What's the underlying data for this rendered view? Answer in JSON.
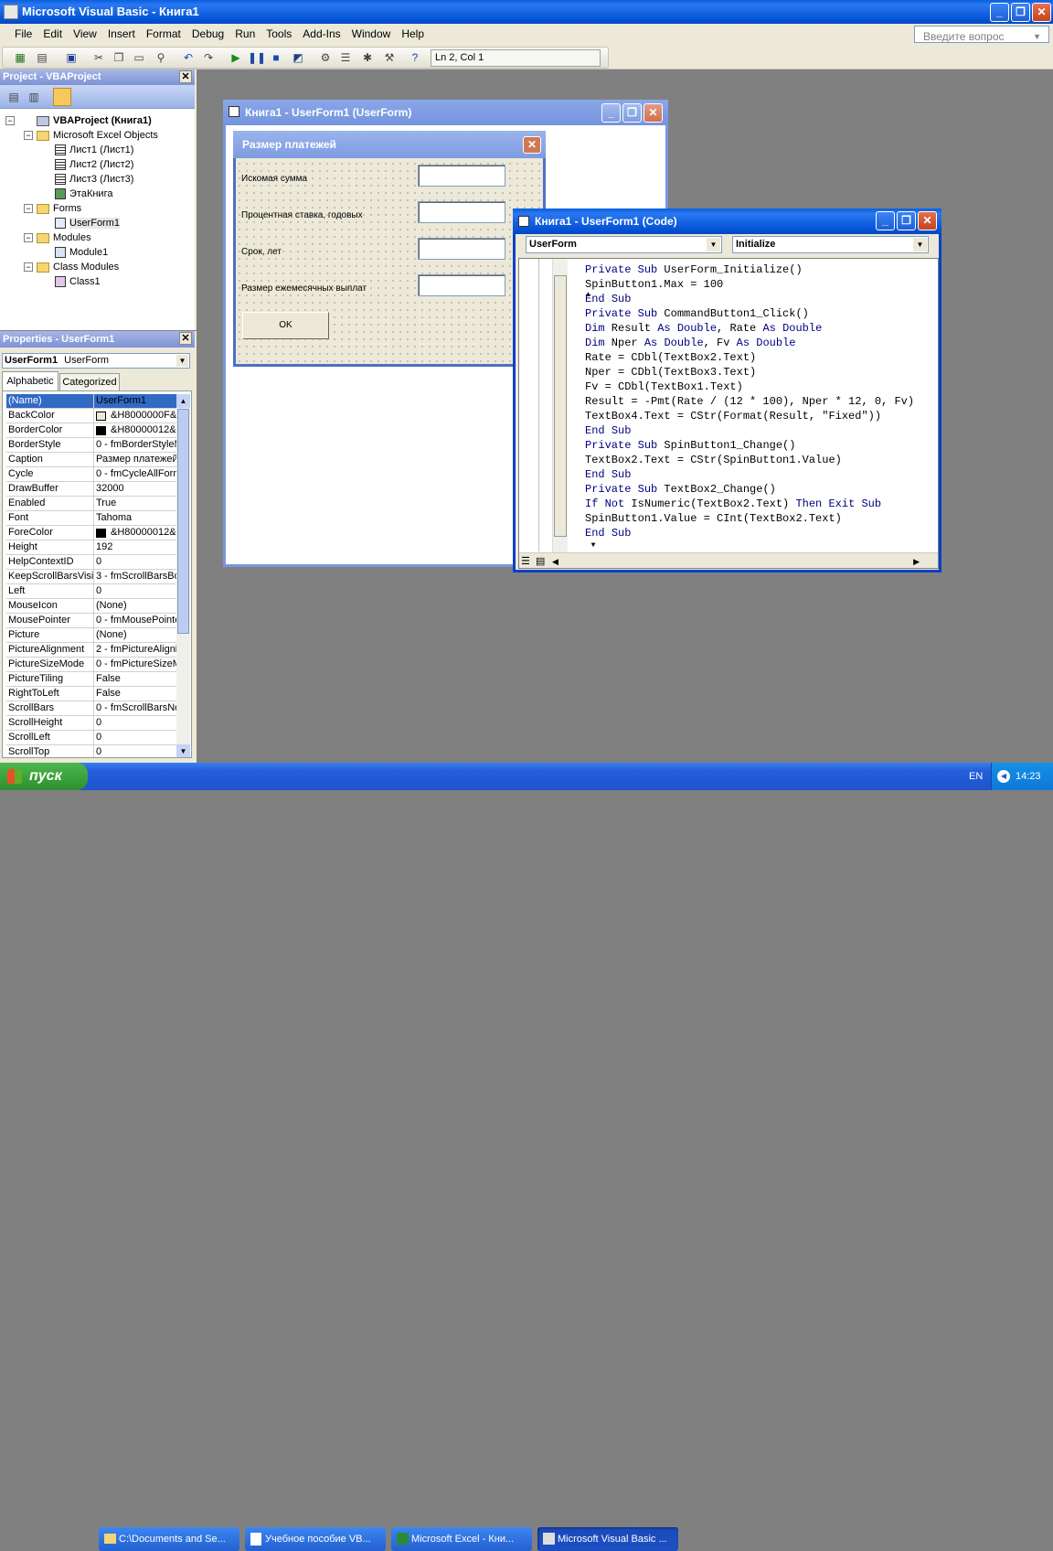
{
  "app": {
    "title": "Microsoft Visual Basic - Книга1",
    "help_placeholder": "Введите вопрос"
  },
  "menu": [
    "File",
    "Edit",
    "View",
    "Insert",
    "Format",
    "Debug",
    "Run",
    "Tools",
    "Add-Ins",
    "Window",
    "Help"
  ],
  "toolbar": {
    "position": "Ln 2, Col 1"
  },
  "project": {
    "title": "Project - VBAProject",
    "root": "VBAProject (Книга1)",
    "excel_objects": "Microsoft Excel Objects",
    "sheets": [
      "Лист1 (Лист1)",
      "Лист2 (Лист2)",
      "Лист3 (Лист3)",
      "ЭтаКнига"
    ],
    "forms": "Forms",
    "userform": "UserForm1",
    "modules": "Modules",
    "module1": "Module1",
    "class_modules": "Class Modules",
    "class1": "Class1"
  },
  "properties": {
    "title": "Properties - UserForm1",
    "object_name": "UserForm1",
    "object_type": "UserForm",
    "tab_alpha": "Alphabetic",
    "tab_cat": "Categorized",
    "rows": [
      {
        "name": "(Name)",
        "value": "UserForm1"
      },
      {
        "name": "BackColor",
        "value": "&H8000000F&"
      },
      {
        "name": "BorderColor",
        "value": "&H80000012&"
      },
      {
        "name": "BorderStyle",
        "value": "0 - fmBorderStyleN"
      },
      {
        "name": "Caption",
        "value": "Размер платежей"
      },
      {
        "name": "Cycle",
        "value": "0 - fmCycleAllForm"
      },
      {
        "name": "DrawBuffer",
        "value": "32000"
      },
      {
        "name": "Enabled",
        "value": "True"
      },
      {
        "name": "Font",
        "value": "Tahoma"
      },
      {
        "name": "ForeColor",
        "value": "&H80000012&"
      },
      {
        "name": "Height",
        "value": "192"
      },
      {
        "name": "HelpContextID",
        "value": "0"
      },
      {
        "name": "KeepScrollBarsVisible",
        "value": "3 - fmScrollBarsBo"
      },
      {
        "name": "Left",
        "value": "0"
      },
      {
        "name": "MouseIcon",
        "value": "(None)"
      },
      {
        "name": "MousePointer",
        "value": "0 - fmMousePointe"
      },
      {
        "name": "Picture",
        "value": "(None)"
      },
      {
        "name": "PictureAlignment",
        "value": "2 - fmPictureAligni"
      },
      {
        "name": "PictureSizeMode",
        "value": "0 - fmPictureSizeM"
      },
      {
        "name": "PictureTiling",
        "value": "False"
      },
      {
        "name": "RightToLeft",
        "value": "False"
      },
      {
        "name": "ScrollBars",
        "value": "0 - fmScrollBarsNc"
      },
      {
        "name": "ScrollHeight",
        "value": "0"
      },
      {
        "name": "ScrollLeft",
        "value": "0"
      },
      {
        "name": "ScrollTop",
        "value": "0"
      }
    ]
  },
  "designer": {
    "title": "Книга1 - UserForm1 (UserForm)",
    "form_caption": "Размер платежей",
    "labels": [
      "Искомая сумма",
      "Процентная ставка, годовых",
      "Срок, лет",
      "Размер ежемесячных выплат"
    ],
    "ok": "OK"
  },
  "code": {
    "title": "Книга1 - UserForm1 (Code)",
    "object": "UserForm",
    "procedure": "Initialize",
    "lines": [
      "Private Sub UserForm_Initialize()",
      "SpinButton1.Max = 100",
      "End Sub",
      "Private Sub CommandButton1_Click()",
      "Dim Result As Double, Rate As Double",
      "Dim Nper As Double, Fv As Double",
      "Rate = CDbl(TextBox2.Text)",
      "Nper = CDbl(TextBox3.Text)",
      "Fv = CDbl(TextBox1.Text)",
      "Result = -Pmt(Rate / (12 * 100), Nper * 12, 0, Fv)",
      "TextBox4.Text = CStr(Format(Result, \"Fixed\"))",
      "End Sub",
      "Private Sub SpinButton1_Change()",
      "TextBox2.Text = CStr(SpinButton1.Value)",
      "End Sub",
      "Private Sub TextBox2_Change()",
      "If Not IsNumeric(TextBox2.Text) Then Exit Sub",
      "SpinButton1.Value = CInt(TextBox2.Text)",
      "End Sub"
    ]
  },
  "taskbar": {
    "start": "пуск",
    "items": [
      "C:\\Documents and Se...",
      "Учебное пособие VB...",
      "Microsoft Excel - Кни...",
      "Microsoft Visual Basic ..."
    ],
    "lang": "EN",
    "time": "14:23"
  }
}
